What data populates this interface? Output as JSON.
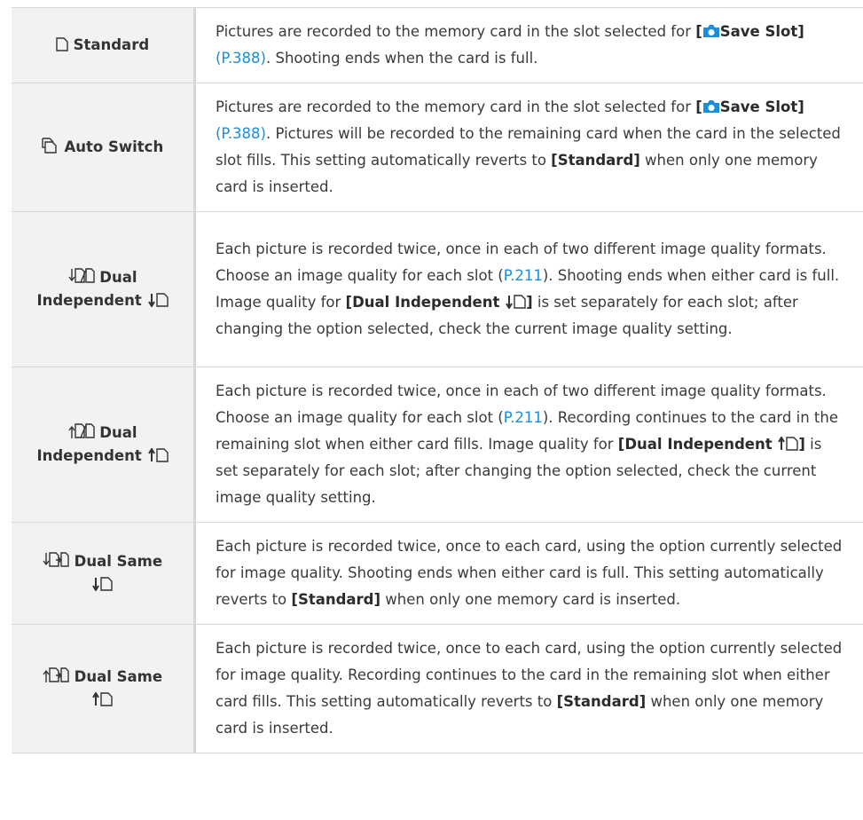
{
  "rows": [
    {
      "name": "Standard",
      "desc": {
        "t1": "Pictures are recorded to the memory card in the slot selected for ",
        "save_slot": "Save Slot]",
        "open": "[",
        "page": "(P.388)",
        "t2": ". Shooting ends when the card is full."
      }
    },
    {
      "name": "Auto Switch",
      "desc": {
        "t1": "Pictures are recorded to the memory card in the slot selected for ",
        "open": "[",
        "save": "Save",
        "slot": "Slot]",
        "page": "(P.388)",
        "t2": ". Pictures will be recorded to the remaining card when the card in the selected slot fills. This setting automatically reverts to ",
        "bold": "[Standard]",
        "t3": " when only one memory card is inserted."
      }
    },
    {
      "name_a": "Dual",
      "name_b": "Independent",
      "desc": {
        "t1": "Each picture is recorded twice, once in each of two different image quality formats. Choose an image quality for each slot (",
        "page": "P.211",
        "t2": "). Shooting ends when either card is full. Image quality for ",
        "bold": "[Dual Independent ",
        "bold_close": "]",
        "t3": " is set separately for each slot; after changing the option selected, check the current image quality setting."
      }
    },
    {
      "name_a": "Dual",
      "name_b": "Independent",
      "desc": {
        "t1": "Each picture is recorded twice, once in each of two different image quality formats. Choose an image quality for each slot (",
        "page": "P.211",
        "t2": "). Recording continues to the card in the remaining slot when either card fills. Image quality for ",
        "bold": "[Dual Independent ",
        "bold_close": "]",
        "t3": " is set separately for each slot; after changing the option selected, check the current image quality setting."
      }
    },
    {
      "name_a": "Dual Same",
      "desc": {
        "t1": "Each picture is recorded twice, once to each card, using the option currently selected for image quality. Shooting ends when either card is full. This setting automatically reverts to ",
        "bold": "[Standard]",
        "t2": " when only one memory card is inserted."
      }
    },
    {
      "name_a": "Dual Same",
      "desc": {
        "t1": "Each picture is recorded twice, once to each card, using the option currently selected for image quality. Recording continues to the card in the remaining slot when either card fills. This setting automatically reverts to ",
        "bold": "[Standard]",
        "t2": " when only one memory card is inserted."
      }
    }
  ],
  "icons": [
    "card-icon",
    "auto-switch-icon",
    "dual-independent-down-icon",
    "dual-independent-up-icon",
    "dual-same-down-icon",
    "dual-same-up-icon",
    "camera-icon",
    "arrow-down-icon",
    "arrow-up-icon"
  ],
  "colors": {
    "link": "#1a8fd9",
    "label_bg": "#f2f2f2",
    "border": "#d8d8d8"
  }
}
